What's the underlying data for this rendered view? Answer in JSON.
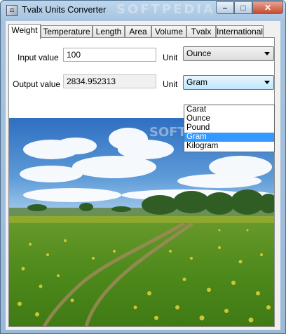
{
  "window": {
    "title": "Tvalx Units Converter",
    "watermark": "SOFTPEDIA",
    "icon": "app-icon"
  },
  "window_controls": {
    "minimize": "–",
    "maximize": "□",
    "close": "✕"
  },
  "tabs": [
    "Weight",
    "Temperature",
    "Length",
    "Area",
    "Volume",
    "Tvalx",
    "International"
  ],
  "active_tab": "Weight",
  "form": {
    "input_label": "Input value",
    "input_value": "100",
    "input_unit_label": "Unit",
    "input_unit": "Ounce",
    "output_label": "Output value",
    "output_value": "2834.952313",
    "output_unit_label": "Unit",
    "output_unit": "Gram"
  },
  "dropdown": {
    "options": [
      "Carat",
      "Ounce",
      "Pound",
      "Gram",
      "Kilogram"
    ],
    "selected": "Gram",
    "highlight_color": "#3399ff"
  },
  "image": {
    "watermark": "SOFTPEDIA"
  }
}
